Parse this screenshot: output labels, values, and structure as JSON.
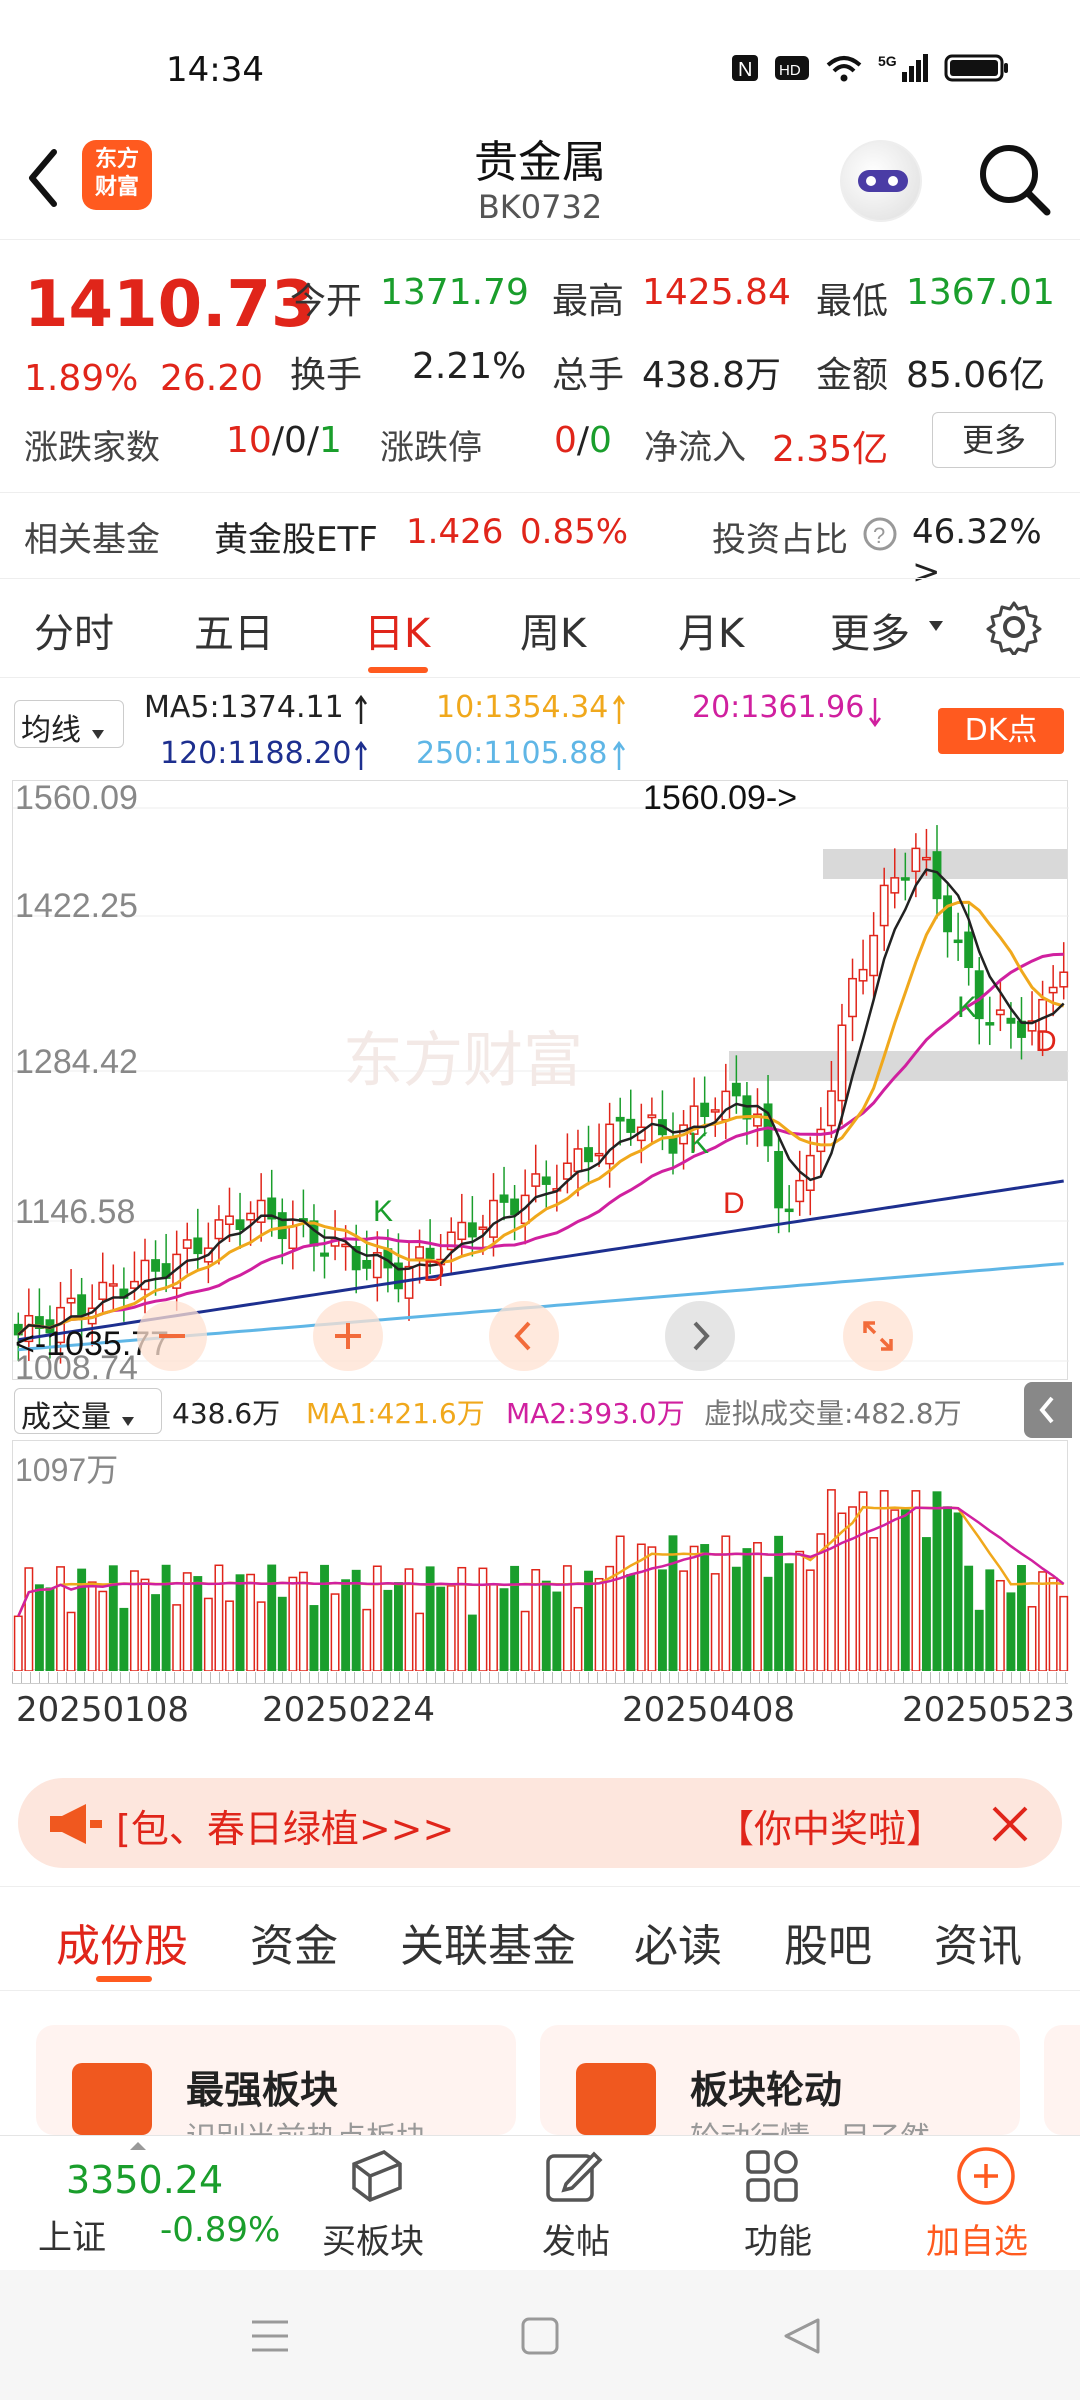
{
  "status": {
    "time": "14:34",
    "network": "5G"
  },
  "header": {
    "title": "贵金属",
    "code": "BK0732",
    "logo_line1": "东方",
    "logo_line2": "财富"
  },
  "quote": {
    "price": "1410.73",
    "change_pct": "1.89%",
    "change": "26.20",
    "open_label": "今开",
    "open": "1371.79",
    "high_label": "最高",
    "high": "1425.84",
    "low_label": "最低",
    "low": "1367.01",
    "turnover_label": "换手",
    "turnover": "2.21%",
    "volume_label": "总手",
    "volume": "438.8万",
    "amount_label": "金额",
    "amount": "85.06亿",
    "updown_label": "涨跌家数",
    "up": "10",
    "flat": "0",
    "down": "1",
    "limit_label": "涨跌停",
    "limit_up": "0",
    "limit_down": "0",
    "inflow_label": "净流入",
    "inflow": "2.35亿",
    "more_button": "更多",
    "sep": "/"
  },
  "fund": {
    "label": "相关基金",
    "name": "黄金股ETF",
    "price": "1.426",
    "pct": "0.85%",
    "ratio_label": "投资占比",
    "ratio": "46.32% >"
  },
  "tabs": [
    "分时",
    "五日",
    "日K",
    "周K",
    "月K",
    "更多"
  ],
  "active_tab": "日K",
  "ma_bar": {
    "select": "均线",
    "ma5": "MA5:1374.11",
    "ma10": "10:1354.34",
    "ma20": "20:1361.96",
    "ma120": "120:1188.20",
    "ma250": "250:1105.88",
    "dk_button": "DK点"
  },
  "kchart": {
    "y_labels": [
      "1560.09",
      "1422.25",
      "1284.42",
      "1146.58",
      "1008.74"
    ],
    "max_label": "1560.09->",
    "min_label": "<-1035.77",
    "markers": [
      "K",
      "D",
      "K",
      "D",
      "K",
      "D"
    ]
  },
  "volume_bar": {
    "select": "成交量",
    "vol": "438.6万",
    "ma1": "MA1:421.6万",
    "ma2": "MA2:393.0万",
    "virtual": "虚拟成交量:482.8万",
    "max_label": "1097万"
  },
  "dates": [
    "20250108",
    "20250224",
    "20250408",
    "20250523"
  ],
  "banner": {
    "left_text": "[包、春日绿植>>>",
    "right_text": "【你中奖啦】"
  },
  "bottom_tabs": [
    "成份股",
    "资金",
    "关联基金",
    "必读",
    "股吧",
    "资讯"
  ],
  "active_bottom_tab": "成份股",
  "cards": [
    {
      "title": "最强板块",
      "sub": "识别当前热点板块"
    },
    {
      "title": "板块轮动",
      "sub": "轮动行情一目了然"
    }
  ],
  "bottombar": {
    "index_value": "3350.24",
    "index_name": "上证",
    "index_pct": "-0.89%",
    "buy": "买板块",
    "post": "发帖",
    "func": "功能",
    "add": "加自选"
  },
  "colors": {
    "red": "#e0251a",
    "green": "#1a9e2c",
    "accent": "#ff5a1f",
    "ma5": "#222222",
    "ma10": "#f0a81c",
    "ma20": "#d0209f",
    "ma120": "#1d2f8f",
    "ma250": "#5fb6e6"
  }
}
